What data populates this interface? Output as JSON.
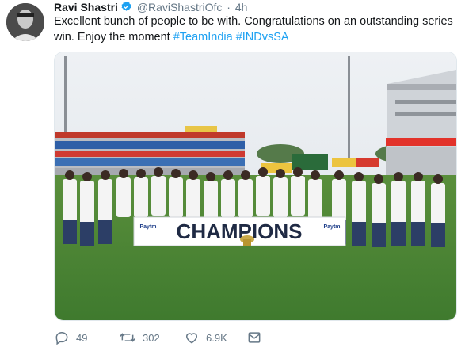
{
  "tweet": {
    "author_name": "Ravi Shastri",
    "handle": "@RaviShastriOfc",
    "separator": "·",
    "time": "4h",
    "text_line1": "Excellent bunch of people to be with. Congratulations on an outstanding series",
    "text_line2_prefix": "win. Enjoy the moment ",
    "hashtag1": "#TeamIndia",
    "hashtag2": "#INDvsSA"
  },
  "media": {
    "banner_text": "CHAMPIONS",
    "sponsor_left": "Paytm",
    "sponsor_right": "Paytm"
  },
  "actions": {
    "replies": "49",
    "retweets": "302",
    "likes": "6.9K"
  },
  "colors": {
    "link": "#1da1f2",
    "muted": "#657786",
    "verified": "#1da1f2",
    "grass": "#3f7a2e"
  }
}
